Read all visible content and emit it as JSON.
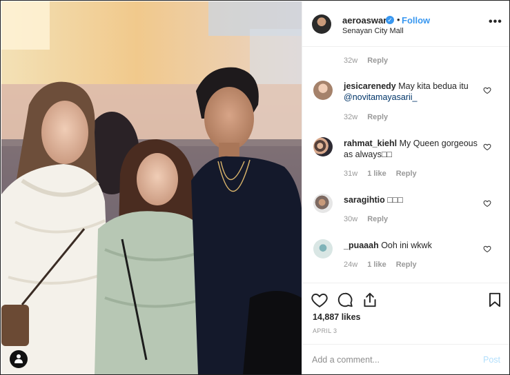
{
  "post": {
    "username": "aeroaswar",
    "verified_glyph": "✓",
    "separator": "•",
    "follow_label": "Follow",
    "location": "Senayan City Mall",
    "more_glyph": "•••"
  },
  "comments": [
    {
      "username": "",
      "text": "",
      "mention": "",
      "time": "32w",
      "likes": "",
      "reply": "Reply"
    },
    {
      "username": "jesicarenedy",
      "text": " May kita bedua itu ",
      "mention": "@novitamayasarii_",
      "time": "32w",
      "likes": "",
      "reply": "Reply"
    },
    {
      "username": "rahmat_kiehl",
      "text": " My Queen gorgeous as always□□",
      "mention": "",
      "time": "31w",
      "likes": "1 like",
      "reply": "Reply"
    },
    {
      "username": "saragihtio",
      "text": " □□□",
      "mention": "",
      "time": "30w",
      "likes": "",
      "reply": "Reply"
    },
    {
      "username": "_puaaah",
      "text": " Ooh ini wkwk",
      "mention": "",
      "time": "24w",
      "likes": "1 like",
      "reply": "Reply"
    }
  ],
  "footer": {
    "likes": "14,887 likes",
    "date": "APRIL 3",
    "comment_placeholder": "Add a comment...",
    "post_label": "Post"
  },
  "icons": {
    "like": "heart-icon",
    "comment": "comment-bubble-icon",
    "share": "share-icon",
    "save": "bookmark-icon",
    "tag": "tagged-people-icon"
  },
  "colors": {
    "link": "#3897f0",
    "mention": "#003569",
    "muted": "#999999",
    "post_disabled": "#b2dffc"
  }
}
